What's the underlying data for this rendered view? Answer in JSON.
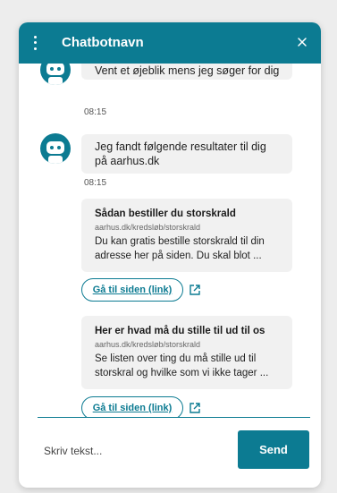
{
  "header": {
    "title": "Chatbotnavn",
    "menu_icon": "kebab-menu-icon",
    "close_icon": "close-icon"
  },
  "messages": [
    {
      "sender": "bot",
      "text": "Vent et øjeblik mens jeg søger for dig",
      "time": "08:15"
    },
    {
      "sender": "bot",
      "text": "Jeg fandt følgende resultater til dig på aarhus.dk",
      "time": "08:15"
    }
  ],
  "results": [
    {
      "title": "Sådan bestiller du storskrald",
      "url": "aarhus.dk/kredsløb/storskrald",
      "description": "Du kan gratis bestille storskrald til din adresse her på siden. Du skal blot ...",
      "link_label": "Gå til siden (link)"
    },
    {
      "title": "Her er hvad må du stille til ud til os",
      "url": "aarhus.dk/kredsløb/storskrald",
      "description": "Se listen over ting du må stille ud til storskral og hvilke som vi ikke tager ...",
      "link_label": "Gå til siden (link)"
    }
  ],
  "composer": {
    "placeholder": "Skriv tekst...",
    "send_label": "Send"
  },
  "colors": {
    "brand": "#0c7b92",
    "bubble": "#f1f1f1",
    "page_bg": "#ededed"
  }
}
